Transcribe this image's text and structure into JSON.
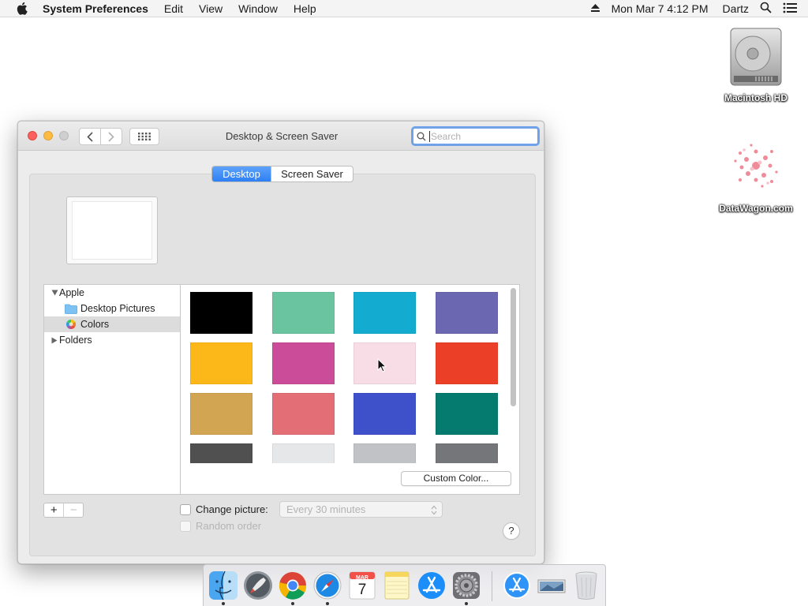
{
  "menubar": {
    "app_name": "System Preferences",
    "menus": [
      "Edit",
      "View",
      "Window",
      "Help"
    ],
    "clock": "Mon Mar 7  4:12 PM",
    "user": "Dartz"
  },
  "desktop": {
    "icons": [
      {
        "label": "Macintosh HD",
        "icon": "hard-drive-icon"
      },
      {
        "label": "DataWagon.com",
        "icon": "flower-image-icon"
      }
    ]
  },
  "window": {
    "title": "Desktop & Screen Saver",
    "search_placeholder": "Search",
    "tabs": [
      {
        "label": "Desktop",
        "active": true
      },
      {
        "label": "Screen Saver",
        "active": false
      }
    ],
    "source_list": {
      "apple": "Apple",
      "desktop_pictures": "Desktop Pictures",
      "colors": "Colors",
      "folders": "Folders",
      "selected": "Colors"
    },
    "swatches": [
      "#000000",
      "#6ac49f",
      "#14abd0",
      "#6c67b1",
      "#fbb818",
      "#cb4d99",
      "#f8dde6",
      "#eb4027",
      "#d2a553",
      "#e36e76",
      "#3f50cb",
      "#047b6e",
      "#505050",
      "#e5e7e8",
      "#c1c2c5",
      "#75767a"
    ],
    "custom_color_label": "Custom Color...",
    "change_picture_label": "Change picture:",
    "interval_value": "Every 30 minutes",
    "random_order_label": "Random order",
    "help_label": "?",
    "add_label": "+",
    "remove_label": "−"
  },
  "dock": {
    "items": [
      "finder-icon",
      "launchpad-icon",
      "chrome-icon",
      "safari-icon",
      "calendar-icon",
      "notes-icon",
      "app-store-icon",
      "system-preferences-icon",
      "app-store-downloads-icon",
      "screenshot-icon",
      "trash-icon"
    ],
    "calendar": {
      "month": "MAR",
      "day": "7"
    }
  },
  "colors": {
    "accent": "#2d7ff5",
    "close": "#fc605c",
    "minimize": "#fdbc40"
  }
}
